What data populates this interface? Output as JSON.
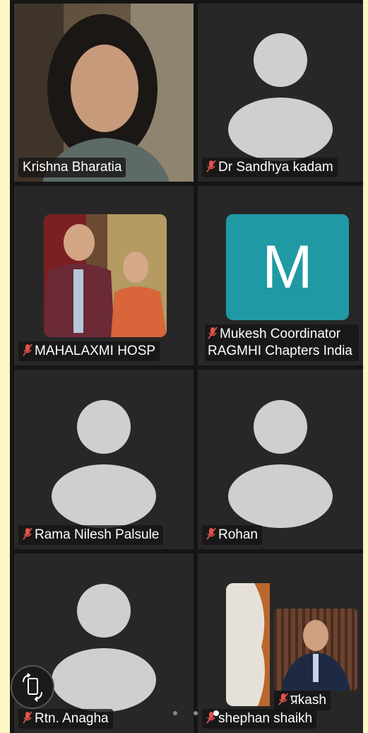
{
  "participants": [
    {
      "name": "Krishna Bharatia",
      "muted": false,
      "active": true
    },
    {
      "name": "Dr Sandhya kadam",
      "muted": true
    },
    {
      "name": "MAHALAXMI HOSP",
      "muted": true
    },
    {
      "name": "Mukesh Coordinator RAGMHI Chapters India",
      "muted": true,
      "avatar_letter": "M",
      "avatar_color": "#1f9aa5"
    },
    {
      "name": "Rama Nilesh Palsule",
      "muted": true
    },
    {
      "name": "Rohan",
      "muted": true
    },
    {
      "name": "Rtn. Anagha",
      "muted": true
    },
    {
      "name": "shephan shaikh",
      "muted": true
    }
  ],
  "self_view": {
    "name": "प्रkash",
    "muted": true
  },
  "icons": {
    "mic_muted": "mic-off-icon",
    "rotate": "screen-rotate-icon"
  },
  "pager": {
    "total": 3,
    "current": 3
  },
  "colors": {
    "active_border": "#3ddc5a",
    "muted_mic": "#e0534a",
    "tile_bg": "#272727"
  }
}
